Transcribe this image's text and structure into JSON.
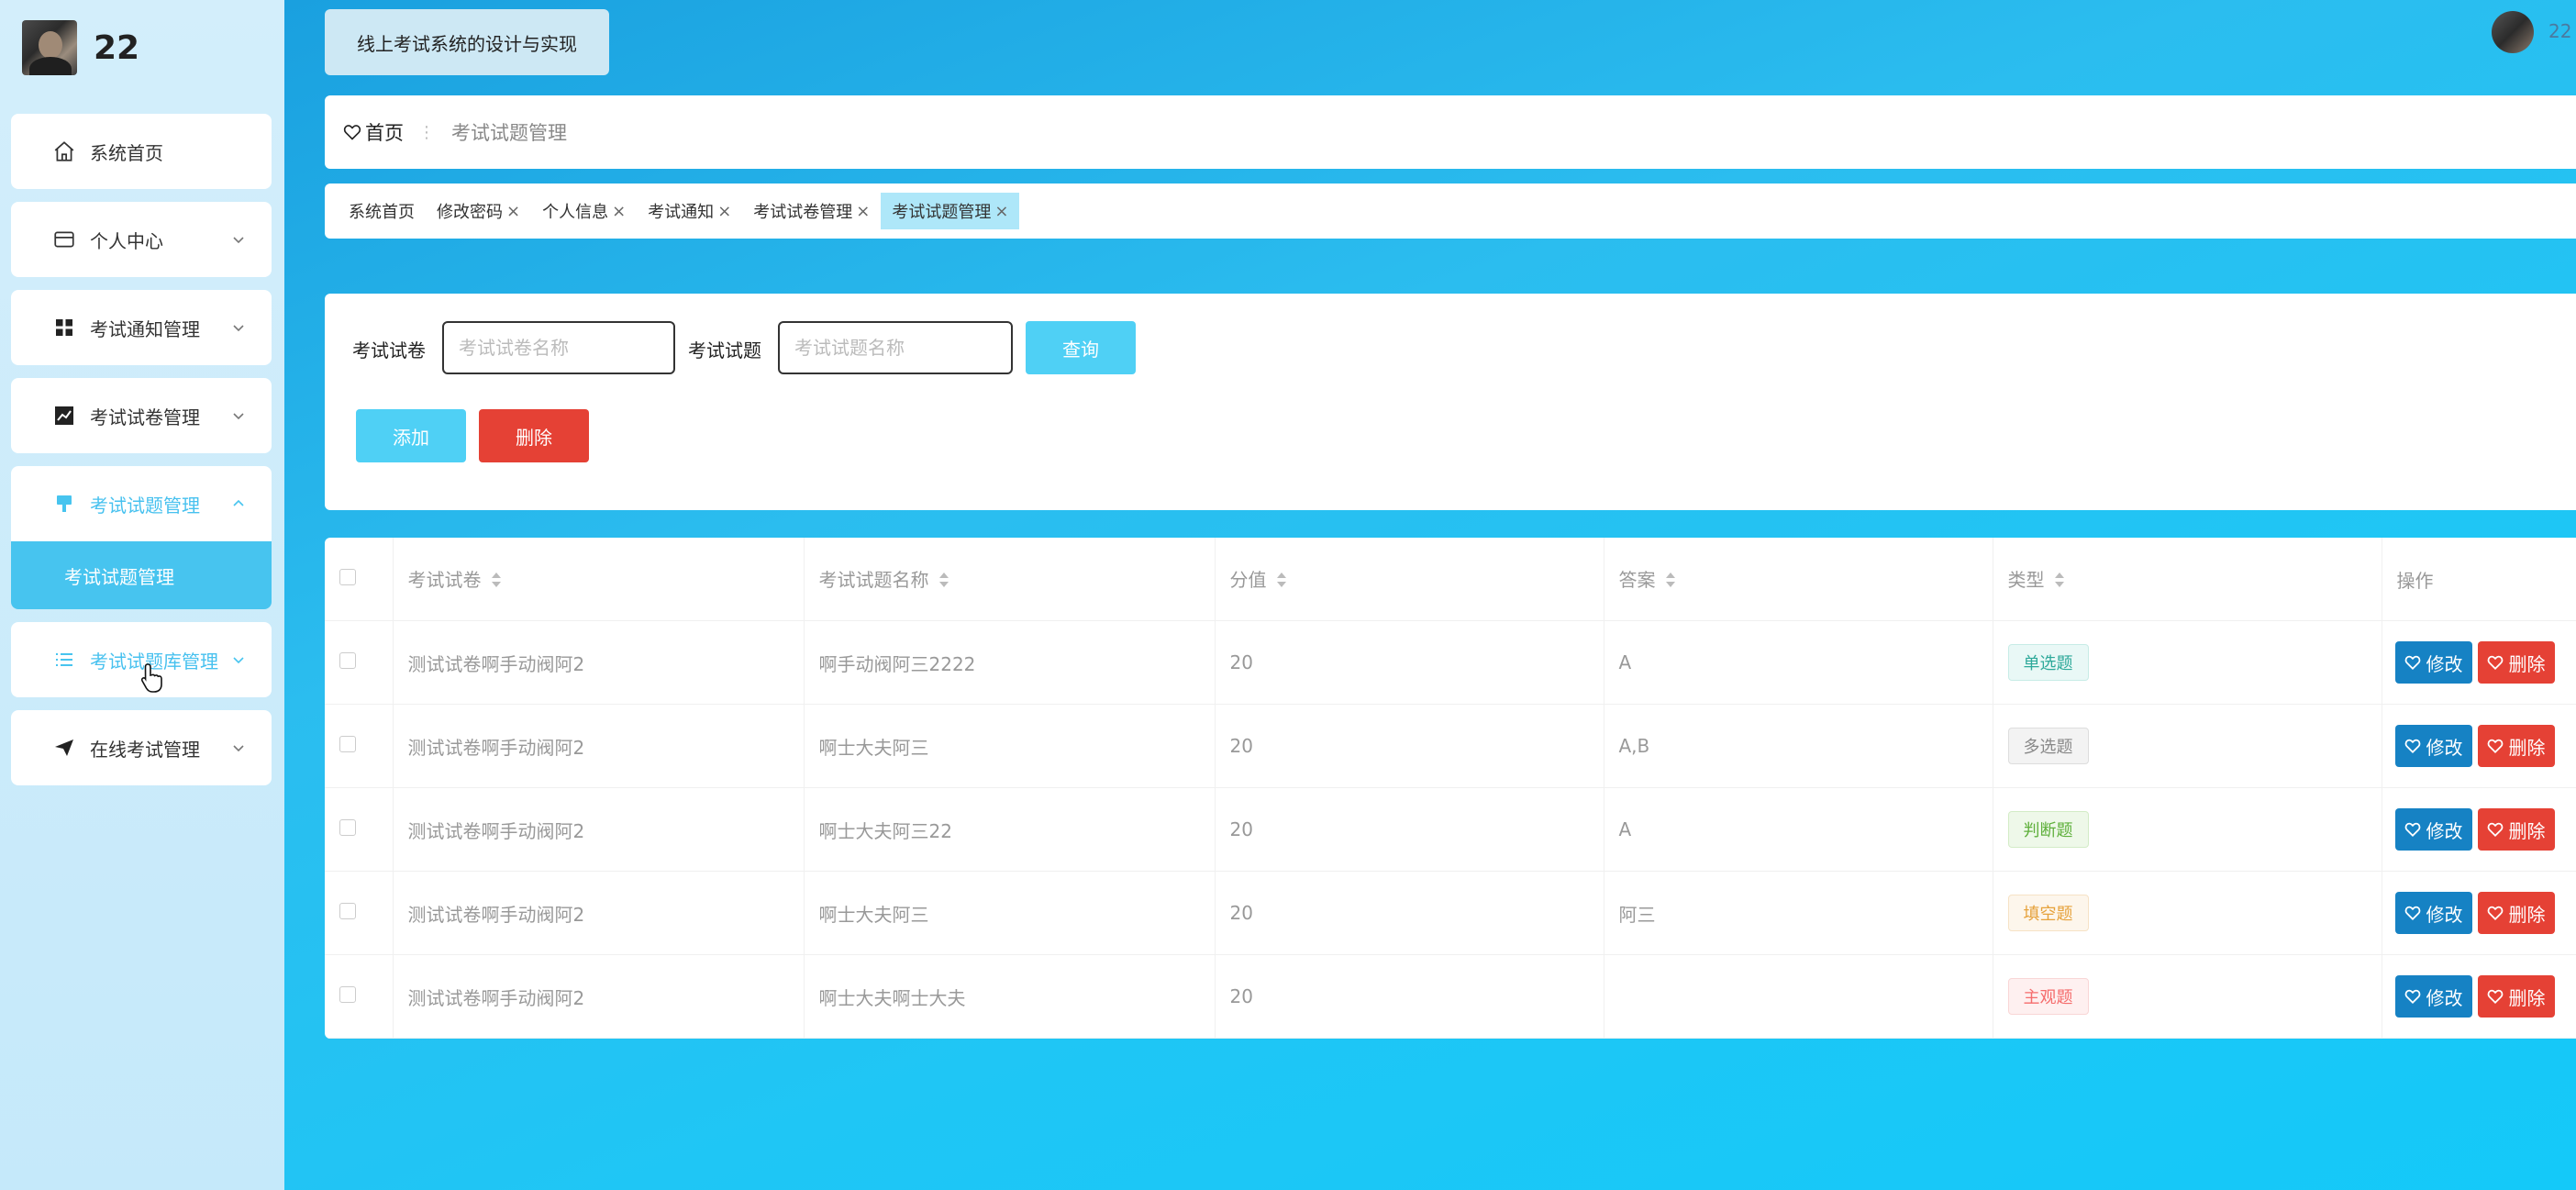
{
  "sidebar": {
    "username": "22",
    "items": [
      {
        "label": "系统首页",
        "icon": "home-icon"
      },
      {
        "label": "个人中心",
        "icon": "card-icon"
      },
      {
        "label": "考试通知管理",
        "icon": "grid-icon"
      },
      {
        "label": "考试试卷管理",
        "icon": "chart-icon"
      },
      {
        "label": "考试试题管理",
        "icon": "brush-icon",
        "sub": "考试试题管理"
      },
      {
        "label": "考试试题库管理",
        "icon": "list-icon"
      },
      {
        "label": "在线考试管理",
        "icon": "send-icon"
      }
    ]
  },
  "header": {
    "system_title": "线上考试系统的设计与实现",
    "user_short": "22"
  },
  "breadcrumb": {
    "home": "首页",
    "current": "考试试题管理"
  },
  "tabs": [
    "系统首页",
    "修改密码",
    "个人信息",
    "考试通知",
    "考试试卷管理",
    "考试试题管理"
  ],
  "search": {
    "paper_label": "考试试卷",
    "paper_placeholder": "考试试卷名称",
    "question_label": "考试试题",
    "question_placeholder": "考试试题名称",
    "query_button": "查询",
    "add_button": "添加",
    "delete_button": "删除"
  },
  "table": {
    "columns": [
      "考试试卷",
      "考试试题名称",
      "分值",
      "答案",
      "类型",
      "操作"
    ],
    "edit_label": "修改",
    "delete_label": "删除",
    "rows": [
      {
        "paper": "测试试卷啊手动阀阿2",
        "question": "啊手动阀阿三2222",
        "score": "20",
        "answer": "A",
        "type": "单选题"
      },
      {
        "paper": "测试试卷啊手动阀阿2",
        "question": "啊士大夫阿三",
        "score": "20",
        "answer": "A,B",
        "type": "多选题"
      },
      {
        "paper": "测试试卷啊手动阀阿2",
        "question": "啊士大夫阿三22",
        "score": "20",
        "answer": "A",
        "type": "判断题"
      },
      {
        "paper": "测试试卷啊手动阀阿2",
        "question": "啊士大夫阿三",
        "score": "20",
        "answer": "阿三",
        "type": "填空题"
      },
      {
        "paper": "测试试卷啊手动阀阿2",
        "question": "啊士大夫啊士大夫",
        "score": "20",
        "answer": "",
        "type": "主观题"
      }
    ]
  },
  "colors": {
    "accent": "#47c4ef",
    "danger": "#e54135",
    "edit": "#1682c4"
  }
}
